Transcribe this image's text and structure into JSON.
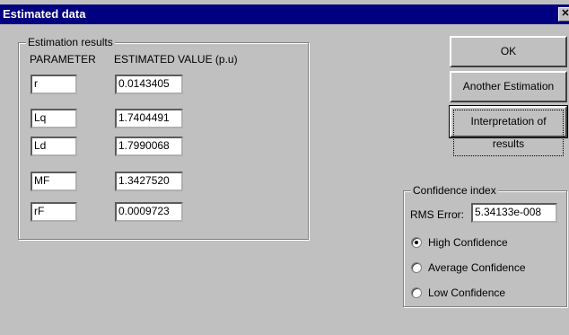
{
  "window": {
    "title": "Estimated data",
    "close_glyph": "✕"
  },
  "results": {
    "group_title": "Estimation results",
    "col_parameter": "PARAMETER",
    "col_value": "ESTIMATED VALUE (p.u)",
    "rows": [
      {
        "parameter": "r",
        "value": "0.0143405"
      },
      {
        "parameter": "Lq",
        "value": "1.7404491"
      },
      {
        "parameter": "Ld",
        "value": "1.7990068"
      },
      {
        "parameter": "MF",
        "value": "1.3427520"
      },
      {
        "parameter": "rF",
        "value": "0.0009723"
      }
    ]
  },
  "buttons": {
    "ok": "OK",
    "another": "Another Estimation",
    "interpretation": "Interpretation of results"
  },
  "confidence": {
    "group_title": "Confidence index",
    "rms_label": "RMS Error:",
    "rms_value": "5.34133e-008",
    "options": [
      "High Confidence",
      "Average Confidence",
      "Low Confidence"
    ],
    "selected": "High Confidence"
  }
}
